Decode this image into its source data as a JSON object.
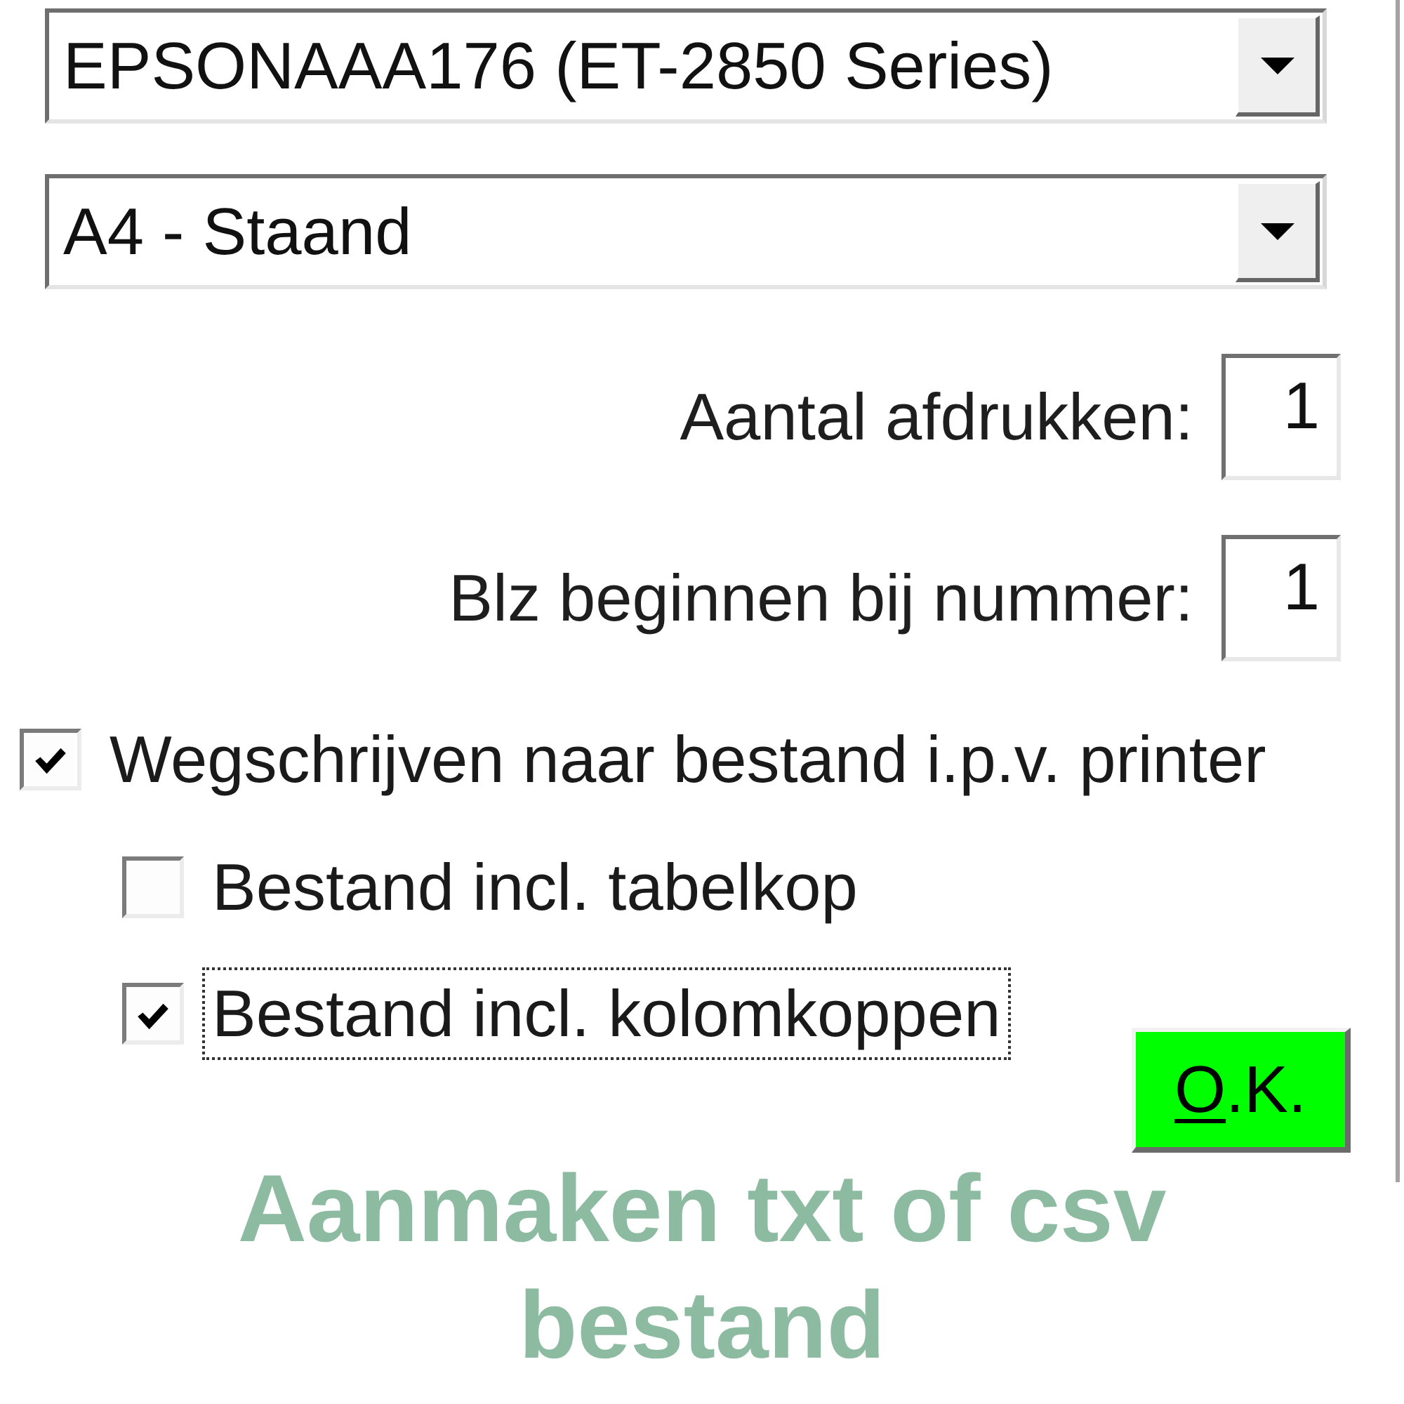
{
  "dropdowns": [
    {
      "value": "EPSONAAA176 (ET-2850 Series)"
    },
    {
      "value": "A4 - Staand"
    }
  ],
  "number_fields": [
    {
      "label": "Aantal afdrukken:",
      "value": "1"
    },
    {
      "label": "Blz beginnen bij nummer:",
      "value": "1"
    }
  ],
  "options": [
    {
      "label": "Wegschrijven naar bestand i.p.v. printer",
      "checked": true,
      "focused": false,
      "children": [
        {
          "label": "Bestand incl. tabelkop",
          "checked": false,
          "focused": false
        },
        {
          "label": "Bestand incl. kolomkoppen",
          "checked": true,
          "focused": true
        }
      ]
    }
  ],
  "ok_button": {
    "label_parts": [
      {
        "text": "O",
        "underlined": true
      },
      {
        "text": ".K.",
        "underlined": false
      }
    ]
  },
  "caption": "Aanmaken txt of csv bestand"
}
